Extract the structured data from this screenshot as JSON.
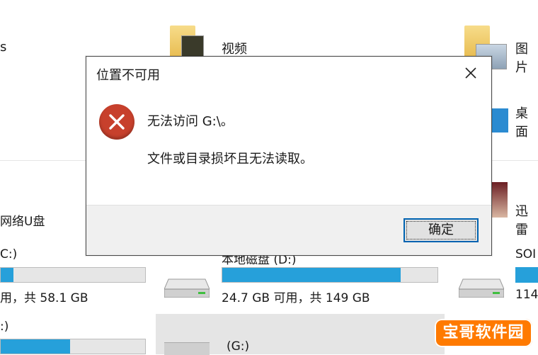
{
  "explorer": {
    "top_left_partial": "s",
    "videos_label": "视频",
    "pictures_label": "图片",
    "desktop_label": "桌面",
    "network_disk_label": "网络U盘",
    "xunlei_label": "迅雷",
    "drive_c_label": "C:)",
    "drive_c_size": "用，共 58.1 GB",
    "drive_c_fill": 0.09,
    "drive_d_label": "本地磁盘 (D:)",
    "drive_d_size": "24.7 GB 可用，共 149 GB",
    "drive_d_fill": 0.83,
    "drive_right_label": "SOI",
    "drive_right_size": "114",
    "drive_g_label": "(G:)",
    "drive_bottom_left_label": ":)",
    "drive_bottom_left_fill": 0.48
  },
  "dialog": {
    "title": "位置不可用",
    "message_line1": "无法访问 G:\\。",
    "message_line2": "文件或目录损坏且无法读取。",
    "ok_label": "确定"
  },
  "watermark": {
    "text": "宝哥软件园"
  },
  "colors": {
    "progress_fill": "#26a0da",
    "error_red": "#c7402c",
    "focus_blue": "#0063b1",
    "watermark_orange": "#ff7a00"
  }
}
